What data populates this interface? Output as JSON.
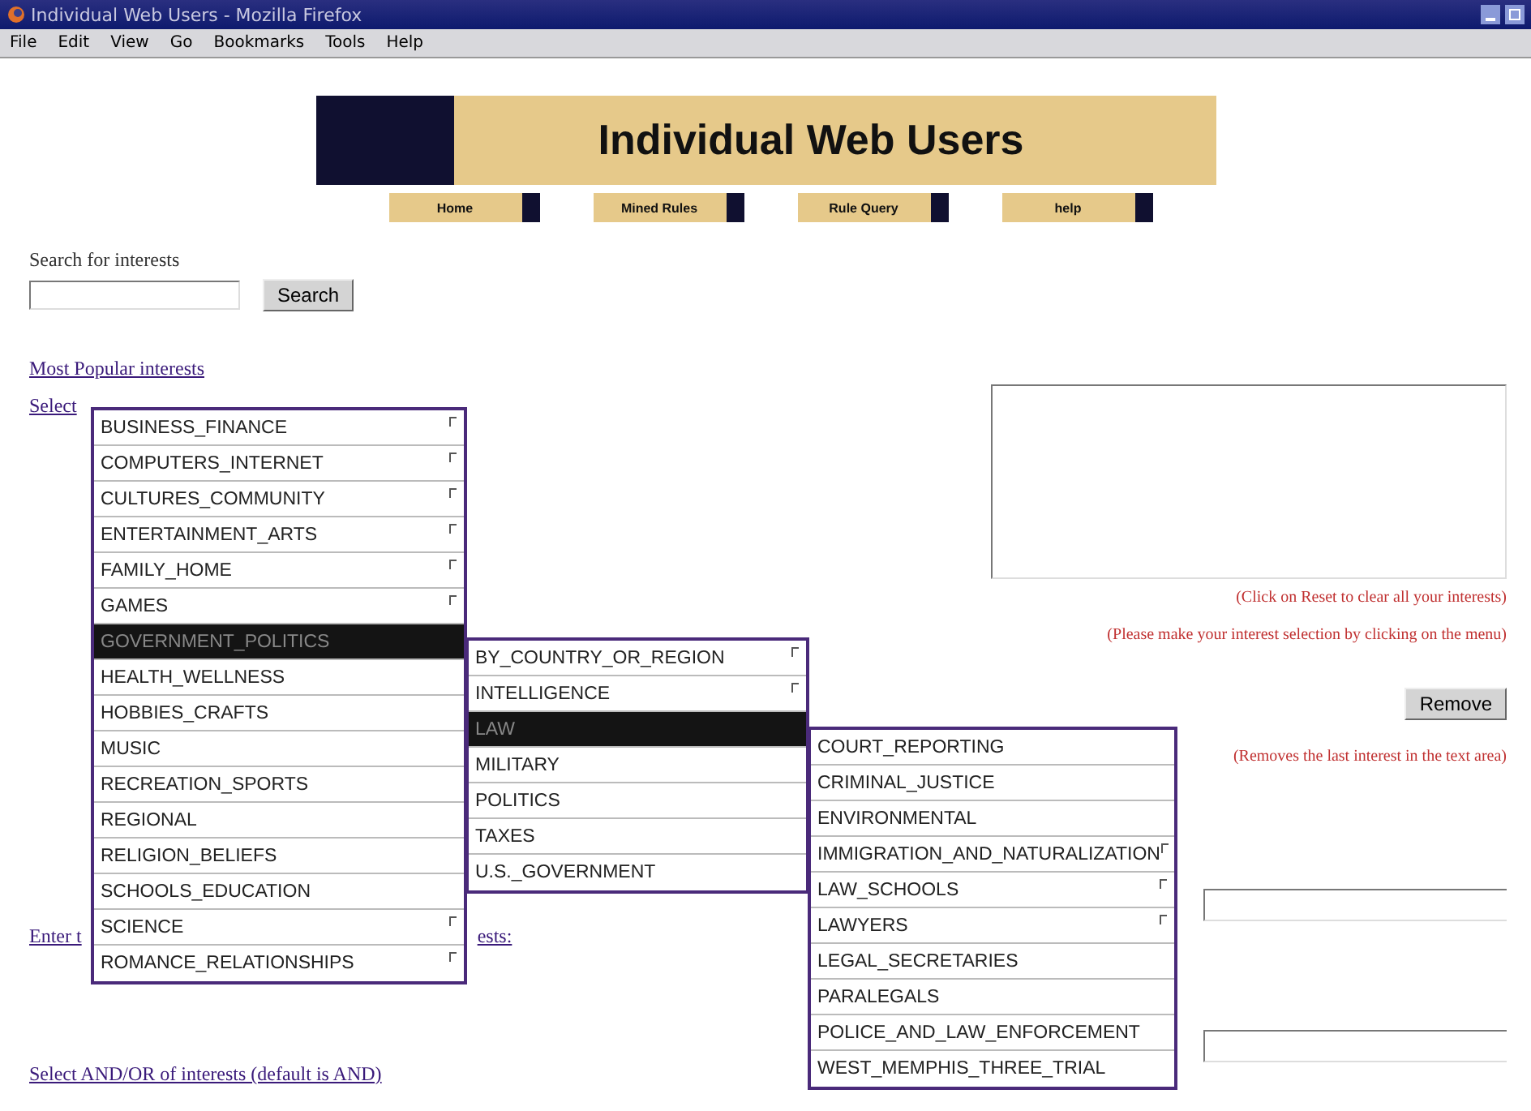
{
  "window": {
    "title": "Individual Web Users - Mozilla Firefox"
  },
  "menu_bar": [
    "File",
    "Edit",
    "View",
    "Go",
    "Bookmarks",
    "Tools",
    "Help"
  ],
  "banner": {
    "title": "Individual Web Users"
  },
  "nav": [
    "Home",
    "Mined Rules",
    "Rule Query",
    "help"
  ],
  "search": {
    "label": "Search for interests",
    "button": "Search"
  },
  "links": {
    "popular": "Most Popular interests",
    "select": "Select",
    "enter_start": "Enter t",
    "enter_end": "ests:",
    "and_or": "Select AND/OR of interests (default is AND)"
  },
  "notes": [
    "(Click on Reset to clear all your interests)",
    "(Please make your interest selection by clicking on the menu)",
    "(Removes the last interest in the text area)"
  ],
  "remove_button": "Remove",
  "menus": [
    {
      "items": [
        {
          "label": "BUSINESS_FINANCE",
          "selected": false,
          "arrow": true
        },
        {
          "label": "COMPUTERS_INTERNET",
          "selected": false,
          "arrow": true
        },
        {
          "label": "CULTURES_COMMUNITY",
          "selected": false,
          "arrow": true
        },
        {
          "label": "ENTERTAINMENT_ARTS",
          "selected": false,
          "arrow": true
        },
        {
          "label": "FAMILY_HOME",
          "selected": false,
          "arrow": true
        },
        {
          "label": "GAMES",
          "selected": false,
          "arrow": true
        },
        {
          "label": "GOVERNMENT_POLITICS",
          "selected": true,
          "arrow": false
        },
        {
          "label": "HEALTH_WELLNESS",
          "selected": false,
          "arrow": false
        },
        {
          "label": "HOBBIES_CRAFTS",
          "selected": false,
          "arrow": false
        },
        {
          "label": "MUSIC",
          "selected": false,
          "arrow": false
        },
        {
          "label": "RECREATION_SPORTS",
          "selected": false,
          "arrow": false
        },
        {
          "label": "REGIONAL",
          "selected": false,
          "arrow": false
        },
        {
          "label": "RELIGION_BELIEFS",
          "selected": false,
          "arrow": false
        },
        {
          "label": "SCHOOLS_EDUCATION",
          "selected": false,
          "arrow": false
        },
        {
          "label": "SCIENCE",
          "selected": false,
          "arrow": true
        },
        {
          "label": "ROMANCE_RELATIONSHIPS",
          "selected": false,
          "arrow": true
        }
      ]
    },
    {
      "items": [
        {
          "label": "BY_COUNTRY_OR_REGION",
          "selected": false,
          "arrow": true
        },
        {
          "label": "INTELLIGENCE",
          "selected": false,
          "arrow": true
        },
        {
          "label": "LAW",
          "selected": true,
          "arrow": false
        },
        {
          "label": "MILITARY",
          "selected": false,
          "arrow": false
        },
        {
          "label": "POLITICS",
          "selected": false,
          "arrow": false
        },
        {
          "label": "TAXES",
          "selected": false,
          "arrow": false
        },
        {
          "label": "U.S._GOVERNMENT",
          "selected": false,
          "arrow": false
        }
      ]
    },
    {
      "items": [
        {
          "label": "COURT_REPORTING",
          "selected": false,
          "arrow": false
        },
        {
          "label": "CRIMINAL_JUSTICE",
          "selected": false,
          "arrow": false
        },
        {
          "label": "ENVIRONMENTAL",
          "selected": false,
          "arrow": false
        },
        {
          "label": "IMMIGRATION_AND_NATURALIZATION",
          "selected": false,
          "arrow": true
        },
        {
          "label": "LAW_SCHOOLS",
          "selected": false,
          "arrow": true
        },
        {
          "label": "LAWYERS",
          "selected": false,
          "arrow": true
        },
        {
          "label": "LEGAL_SECRETARIES",
          "selected": false,
          "arrow": false
        },
        {
          "label": "PARALEGALS",
          "selected": false,
          "arrow": false
        },
        {
          "label": "POLICE_AND_LAW_ENFORCEMENT",
          "selected": false,
          "arrow": false
        },
        {
          "label": "WEST_MEMPHIS_THREE_TRIAL",
          "selected": false,
          "arrow": false
        }
      ]
    }
  ]
}
